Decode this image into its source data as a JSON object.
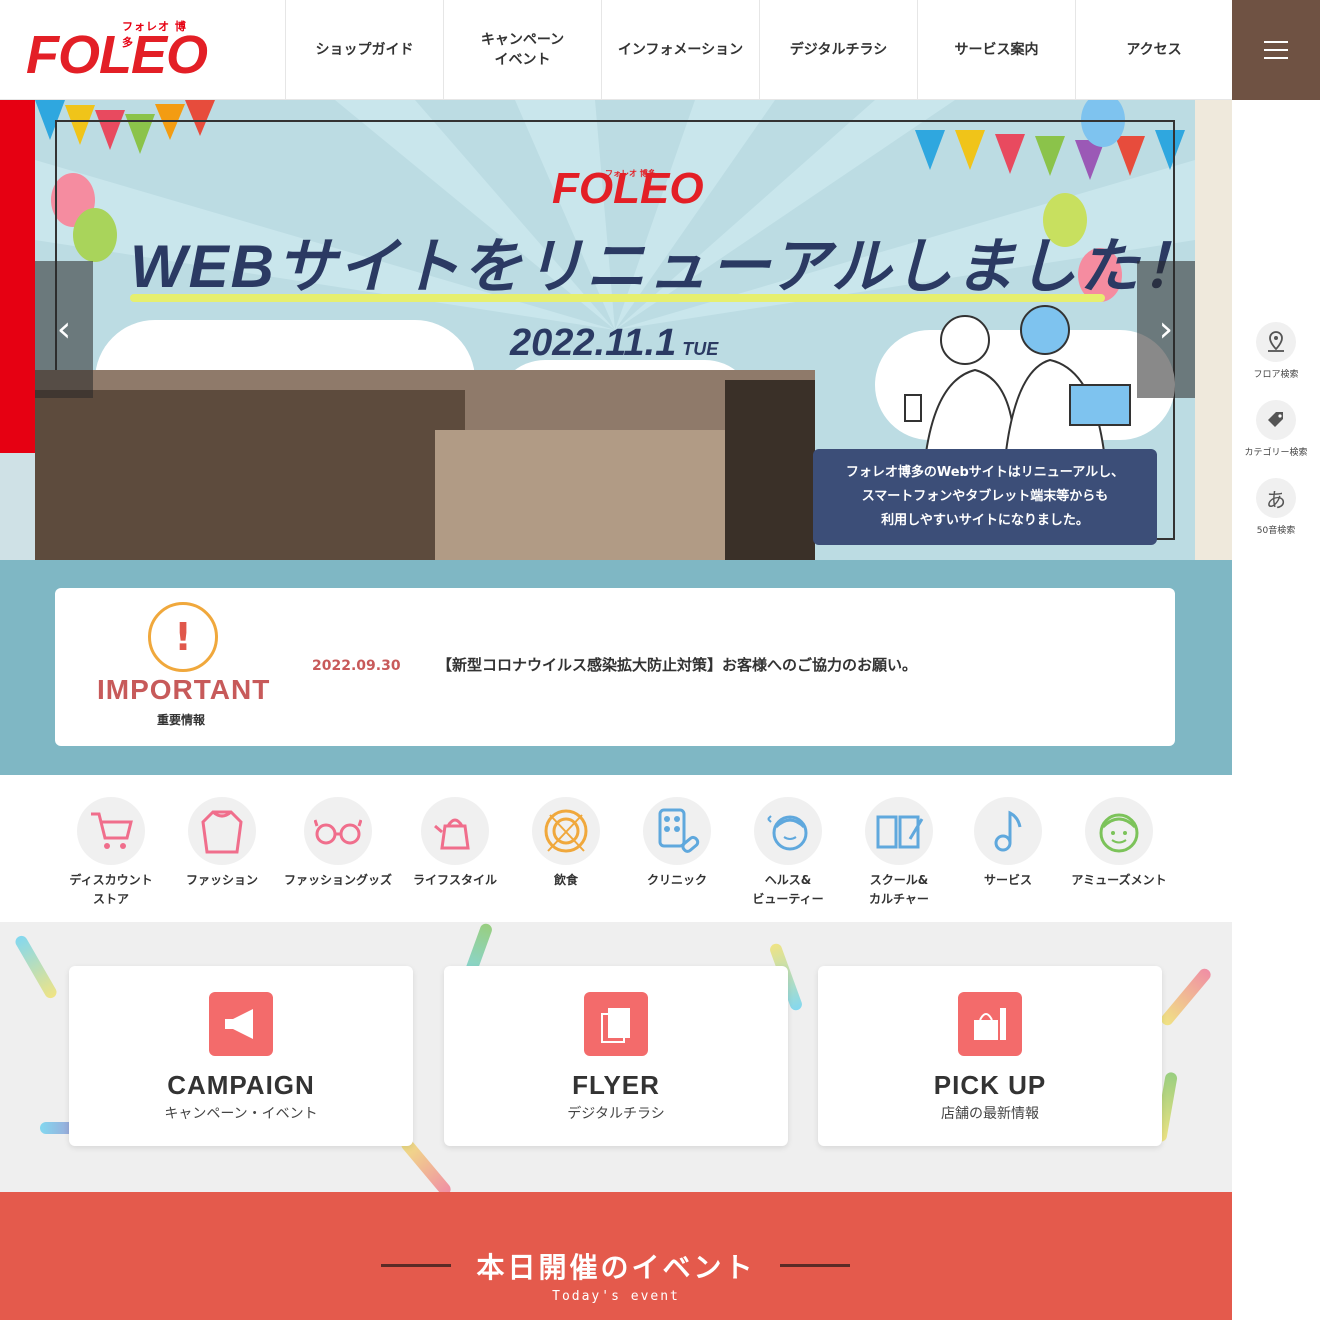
{
  "logo": {
    "sub": "フォレオ 博多",
    "main": "FOLEO"
  },
  "nav": {
    "items": [
      {
        "label": "ショップガイド"
      },
      {
        "label": "キャンペーン\nイベント"
      },
      {
        "label": "インフォメーション"
      },
      {
        "label": "デジタルチラシ"
      },
      {
        "label": "サービス案内"
      },
      {
        "label": "アクセス"
      }
    ]
  },
  "side": {
    "items": [
      {
        "label": "フロア検索",
        "icon": "map-pin-icon"
      },
      {
        "label": "カテゴリー検索",
        "icon": "tag-icon"
      },
      {
        "label": "50音検索",
        "icon": "a-kana-icon",
        "glyph": "あ"
      }
    ]
  },
  "hero": {
    "logo_sub": "フォレオ 博多",
    "logo": "FOLEO",
    "title": "WEBサイトをリニューアルしました！",
    "date": "2022.11.1",
    "day": "TUE",
    "caption": "フォレオ博多のWebサイトはリニューアルし、\nスマートフォンやタブレット端末等からも\n利用しやすいサイトになりました。",
    "prev": "‹",
    "next": "›"
  },
  "important": {
    "icon": "!",
    "title": "IMPORTANT",
    "subtitle": "重要情報",
    "date": "2022.09.30",
    "text": "【新型コロナウイルス感染拡大防止対策】お客様へのご協力のお願い。"
  },
  "categories": [
    {
      "label": "ディスカウント\nストア",
      "icon": "cart-icon",
      "glyph": "🛒"
    },
    {
      "label": "ファッション",
      "icon": "sweater-icon",
      "glyph": "👕"
    },
    {
      "label": "ファッショングッズ",
      "icon": "glasses-icon",
      "glyph": "👓"
    },
    {
      "label": "ライフスタイル",
      "icon": "kettle-icon",
      "glyph": "☕"
    },
    {
      "label": "飲食",
      "icon": "plate-icon",
      "glyph": "🍽"
    },
    {
      "label": "クリニック",
      "icon": "pills-icon",
      "glyph": "💊"
    },
    {
      "label": "ヘルス&\nビューティー",
      "icon": "face-icon",
      "glyph": "✨"
    },
    {
      "label": "スクール&\nカルチャー",
      "icon": "book-icon",
      "glyph": "📖"
    },
    {
      "label": "サービス",
      "icon": "music-note-icon",
      "glyph": "♪"
    },
    {
      "label": "アミューズメント",
      "icon": "smile-icon",
      "glyph": "☺"
    }
  ],
  "cards": [
    {
      "title": "CAMPAIGN",
      "sub": "キャンペーン・イベント",
      "icon": "megaphone-icon",
      "glyph": "📣"
    },
    {
      "title": "FLYER",
      "sub": "デジタルチラシ",
      "icon": "flyer-icon",
      "glyph": "📄"
    },
    {
      "title": "PICK UP",
      "sub": "店舗の最新情報",
      "icon": "shopping-bag-icon",
      "glyph": "🛍"
    }
  ],
  "events": {
    "title": "本日開催のイベント",
    "sub": "Today's event"
  },
  "colors": {
    "brand_red": "#e31f26",
    "menu_brown": "#6f5243",
    "teal": "#7fb7c4",
    "event_red": "#e45a4c"
  }
}
